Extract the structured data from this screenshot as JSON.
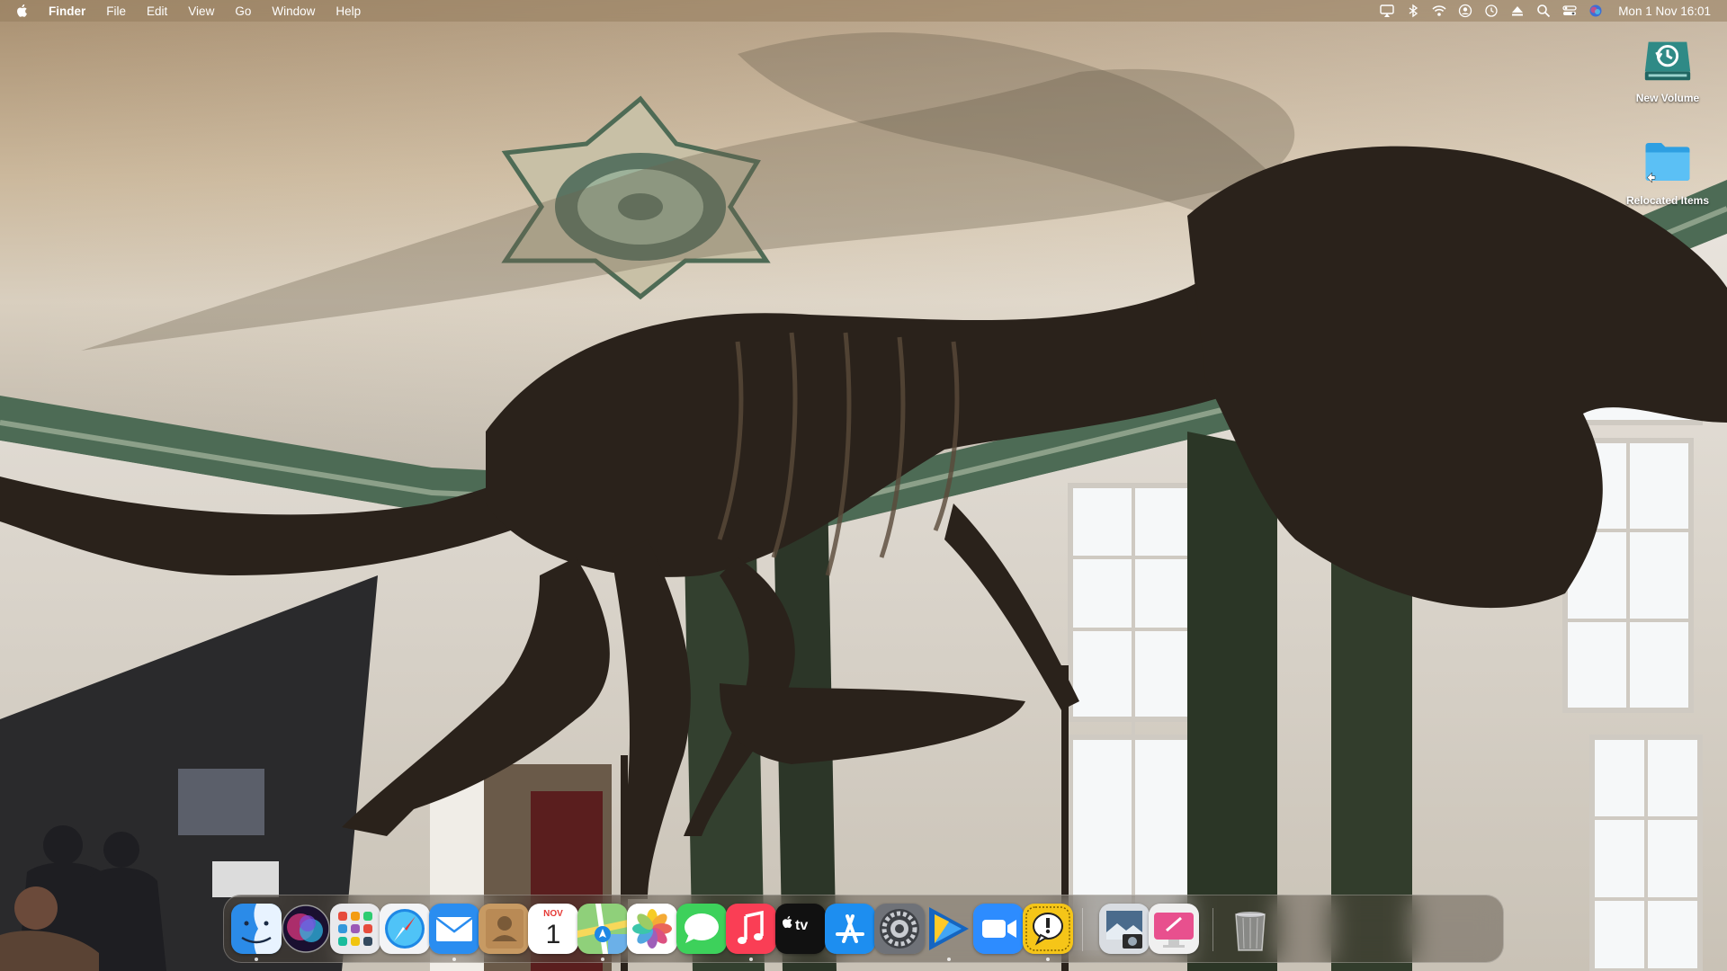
{
  "menubar": {
    "apple_icon": "apple-logo-icon",
    "app_name": "Finder",
    "menus": [
      "File",
      "Edit",
      "View",
      "Go",
      "Window",
      "Help"
    ],
    "status_icons": [
      "screen-mirroring-icon",
      "bluetooth-icon",
      "wifi-icon",
      "user-account-icon",
      "time-machine-icon",
      "eject-icon",
      "spotlight-search-icon",
      "control-center-icon",
      "siri-icon"
    ],
    "clock": "Mon 1 Nov  16:01"
  },
  "desktop": {
    "icons": [
      {
        "label": "New Volume",
        "icon": "time-machine-drive-icon"
      },
      {
        "label": "Relocated Items",
        "icon": "folder-alias-icon"
      }
    ]
  },
  "dock": {
    "apps": [
      {
        "name": "Finder",
        "icon": "finder-icon",
        "running": true
      },
      {
        "name": "Siri",
        "icon": "siri-icon",
        "running": false
      },
      {
        "name": "Launchpad",
        "icon": "launchpad-icon",
        "running": false
      },
      {
        "name": "Safari",
        "icon": "safari-icon",
        "running": false
      },
      {
        "name": "Mail",
        "icon": "mail-icon",
        "running": true
      },
      {
        "name": "Contacts",
        "icon": "contacts-icon",
        "running": false
      },
      {
        "name": "Calendar",
        "icon": "calendar-icon",
        "running": false,
        "month": "NOV",
        "day": "1"
      },
      {
        "name": "Maps",
        "icon": "maps-icon",
        "running": true
      },
      {
        "name": "Photos",
        "icon": "photos-icon",
        "running": false
      },
      {
        "name": "Messages",
        "icon": "messages-icon",
        "running": false
      },
      {
        "name": "Music",
        "icon": "music-icon",
        "running": true
      },
      {
        "name": "TV",
        "icon": "apple-tv-icon",
        "running": false,
        "label": "tv"
      },
      {
        "name": "App Store",
        "icon": "app-store-icon",
        "running": false
      },
      {
        "name": "System Preferences",
        "icon": "system-preferences-icon",
        "running": false
      },
      {
        "name": "Infuse",
        "icon": "infuse-icon",
        "running": true
      },
      {
        "name": "Zoom",
        "icon": "zoom-icon",
        "running": false
      },
      {
        "name": "Feedback Assistant",
        "icon": "feedback-assistant-icon",
        "running": true
      },
      {
        "name": "Preview",
        "icon": "preview-icon",
        "running": false
      },
      {
        "name": "CleanMyMac",
        "icon": "cleanmymac-icon",
        "running": false
      },
      {
        "name": "Trash",
        "icon": "trash-icon",
        "running": false
      }
    ]
  }
}
